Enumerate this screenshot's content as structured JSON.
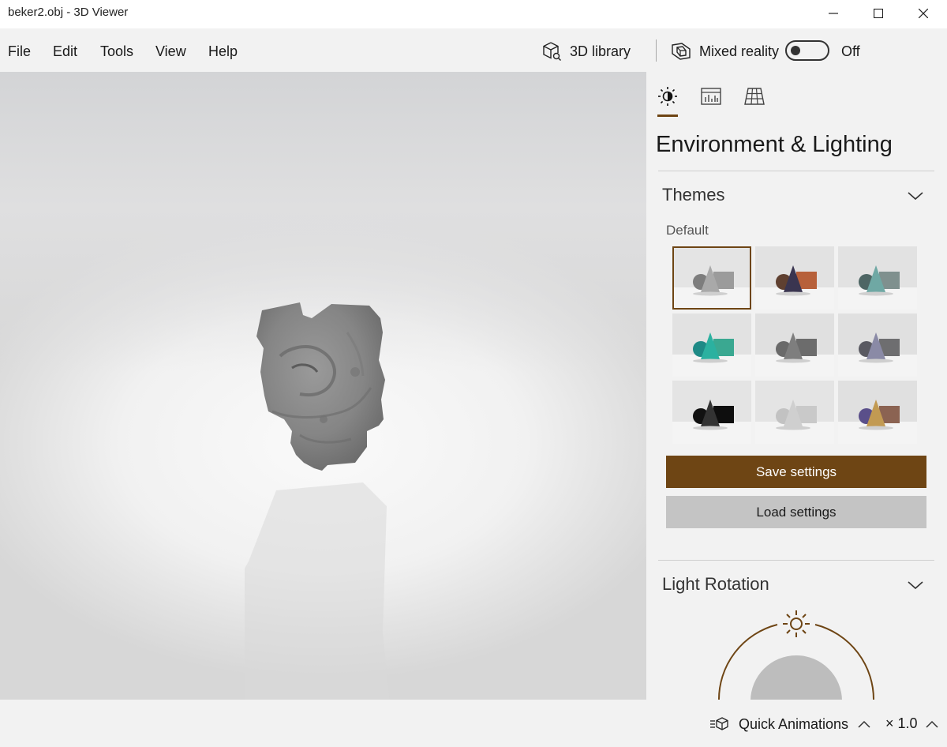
{
  "window": {
    "title": "beker2.obj - 3D Viewer"
  },
  "menu": {
    "items": [
      "File",
      "Edit",
      "Tools",
      "View",
      "Help"
    ],
    "library_label": "3D library",
    "mixed_reality_label": "Mixed reality",
    "toggle_state": "Off"
  },
  "panel": {
    "tabs": [
      "sun-icon",
      "stats-icon",
      "grid-icon"
    ],
    "title": "Environment & Lighting",
    "themes_header": "Themes",
    "themes_sublabel": "Default",
    "themes": [
      {
        "bg": "#e4e4e4",
        "sphere": "#7d7d7d",
        "cone": "#a9a9a9",
        "box": "#9b9b9b",
        "selected": true
      },
      {
        "bg": "#e2e2e2",
        "sphere": "#5f4030",
        "cone": "#3a3550",
        "box": "#b7603a",
        "selected": false
      },
      {
        "bg": "#e2e2e2",
        "sphere": "#4e6664",
        "cone": "#6fa8a4",
        "box": "#7f908e",
        "selected": false
      },
      {
        "bg": "#e2e2e2",
        "sphere": "#1e8a86",
        "cone": "#2bb1a0",
        "box": "#3aa891",
        "selected": false
      },
      {
        "bg": "#e0e0e0",
        "sphere": "#6a6a6a",
        "cone": "#7e7e7e",
        "box": "#6c6c6c",
        "selected": false
      },
      {
        "bg": "#e0e0e0",
        "sphere": "#5a5a62",
        "cone": "#8a8aa6",
        "box": "#6e6e70",
        "selected": false
      },
      {
        "bg": "#e4e4e4",
        "sphere": "#111111",
        "cone": "#333333",
        "box": "#0e0e0e",
        "selected": false
      },
      {
        "bg": "#e4e4e4",
        "sphere": "#c2c2c2",
        "cone": "#cfcfcf",
        "box": "#c9c9c9",
        "selected": false
      },
      {
        "bg": "#e0e0e0",
        "sphere": "#5a4f8a",
        "cone": "#c29a52",
        "box": "#8b6352",
        "selected": false
      }
    ],
    "save_label": "Save settings",
    "load_label": "Load settings",
    "light_header": "Light Rotation"
  },
  "status": {
    "quick_animations_label": "Quick Animations",
    "speed_label": "× 1.0"
  },
  "colors": {
    "accent": "#6e4514",
    "secondary_button": "#c4c4c4",
    "panel_bg": "#f2f2f2"
  }
}
